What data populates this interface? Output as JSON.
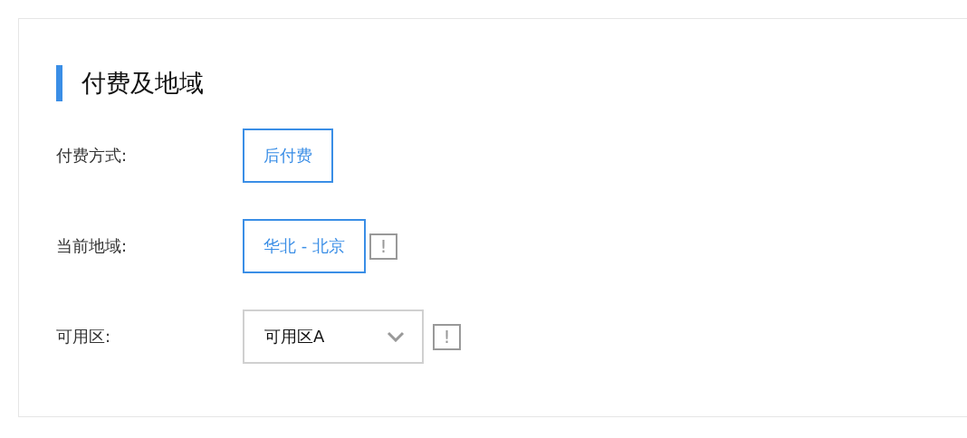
{
  "section": {
    "title": "付费及地域"
  },
  "fields": [
    {
      "label": "付费方式:",
      "kind": "option",
      "value": "后付费",
      "selected": true
    },
    {
      "label": "当前地域:",
      "kind": "option",
      "value": "华北 - 北京",
      "selected": true,
      "info_mark": "!"
    },
    {
      "label": "可用区:",
      "kind": "select",
      "value": "可用区A",
      "info_mark": "!"
    }
  ]
}
